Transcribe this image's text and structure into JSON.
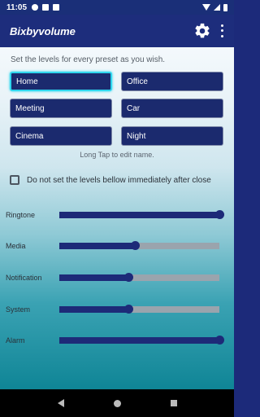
{
  "status_bar": {
    "time": "11:05"
  },
  "app_bar": {
    "title": "Bixbyvolume",
    "settings_icon": "gear-icon",
    "overflow_icon": "more-vert-icon"
  },
  "intro_text": "Set the levels for every preset as you wish.",
  "presets": [
    {
      "label": "Home",
      "active": true
    },
    {
      "label": "Office",
      "active": false
    },
    {
      "label": "Meeting",
      "active": false
    },
    {
      "label": "Car",
      "active": false
    },
    {
      "label": "Cinema",
      "active": false
    },
    {
      "label": "Night",
      "active": false
    }
  ],
  "hint_text": "Long Tap to edit name.",
  "checkbox": {
    "label": "Do not set the levels bellow immediately after close",
    "checked": false
  },
  "sliders": [
    {
      "label": "Ringtone",
      "value": 1.0
    },
    {
      "label": "Media",
      "value": 0.47
    },
    {
      "label": "Notification",
      "value": 0.43
    },
    {
      "label": "System",
      "value": 0.43
    },
    {
      "label": "Alarm",
      "value": 1.0
    }
  ],
  "colors": {
    "primary": "#1d2a78",
    "accent": "#2fd6ee",
    "track": "#9aa4ad"
  }
}
